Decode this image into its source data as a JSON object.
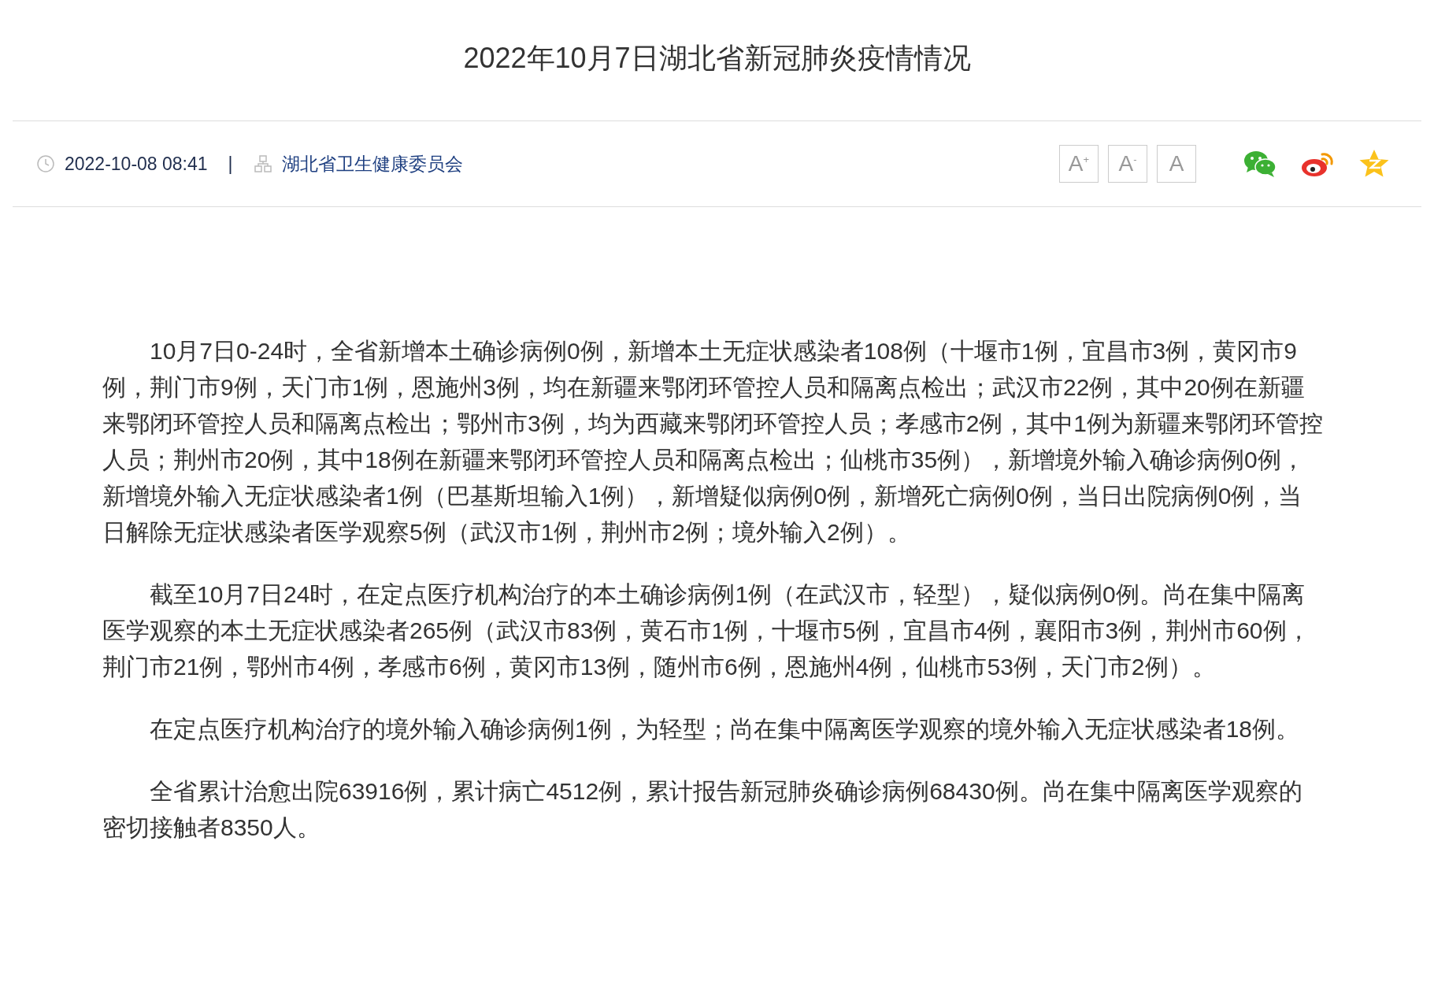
{
  "article": {
    "title": "2022年10月7日湖北省新冠肺炎疫情情况",
    "meta": {
      "date": "2022-10-08 08:41",
      "separator": "|",
      "source": "湖北省卫生健康委员会"
    },
    "font_buttons": [
      {
        "label": "A",
        "sign": "+"
      },
      {
        "label": "A",
        "sign": "-"
      },
      {
        "label": "A"
      }
    ],
    "share": [
      {
        "kind": "wechat"
      },
      {
        "kind": "weibo"
      },
      {
        "kind": "qzone"
      }
    ],
    "paragraphs": [
      "10月7日0-24时，全省新增本土确诊病例0例，新增本土无症状感染者108例（十堰市1例，宜昌市3例，黄冈市9例，荆门市9例，天门市1例，恩施州3例，均在新疆来鄂闭环管控人员和隔离点检出；武汉市22例，其中20例在新疆来鄂闭环管控人员和隔离点检出；鄂州市3例，均为西藏来鄂闭环管控人员；孝感市2例，其中1例为新疆来鄂闭环管控人员；荆州市20例，其中18例在新疆来鄂闭环管控人员和隔离点检出；仙桃市35例），新增境外输入确诊病例0例，新增境外输入无症状感染者1例（巴基斯坦输入1例），新增疑似病例0例，新增死亡病例0例，当日出院病例0例，当日解除无症状感染者医学观察5例（武汉市1例，荆州市2例；境外输入2例）。",
      "截至10月7日24时，在定点医疗机构治疗的本土确诊病例1例（在武汉市，轻型），疑似病例0例。尚在集中隔离医学观察的本土无症状感染者265例（武汉市83例，黄石市1例，十堰市5例，宜昌市4例，襄阳市3例，荆州市60例，荆门市21例，鄂州市4例，孝感市6例，黄冈市13例，随州市6例，恩施州4例，仙桃市53例，天门市2例）。",
      "在定点医疗机构治疗的境外输入确诊病例1例，为轻型；尚在集中隔离医学观察的境外输入无症状感染者18例。",
      "全省累计治愈出院63916例，累计病亡4512例，累计报告新冠肺炎确诊病例68430例。尚在集中隔离医学观察的密切接触者8350人。"
    ]
  }
}
